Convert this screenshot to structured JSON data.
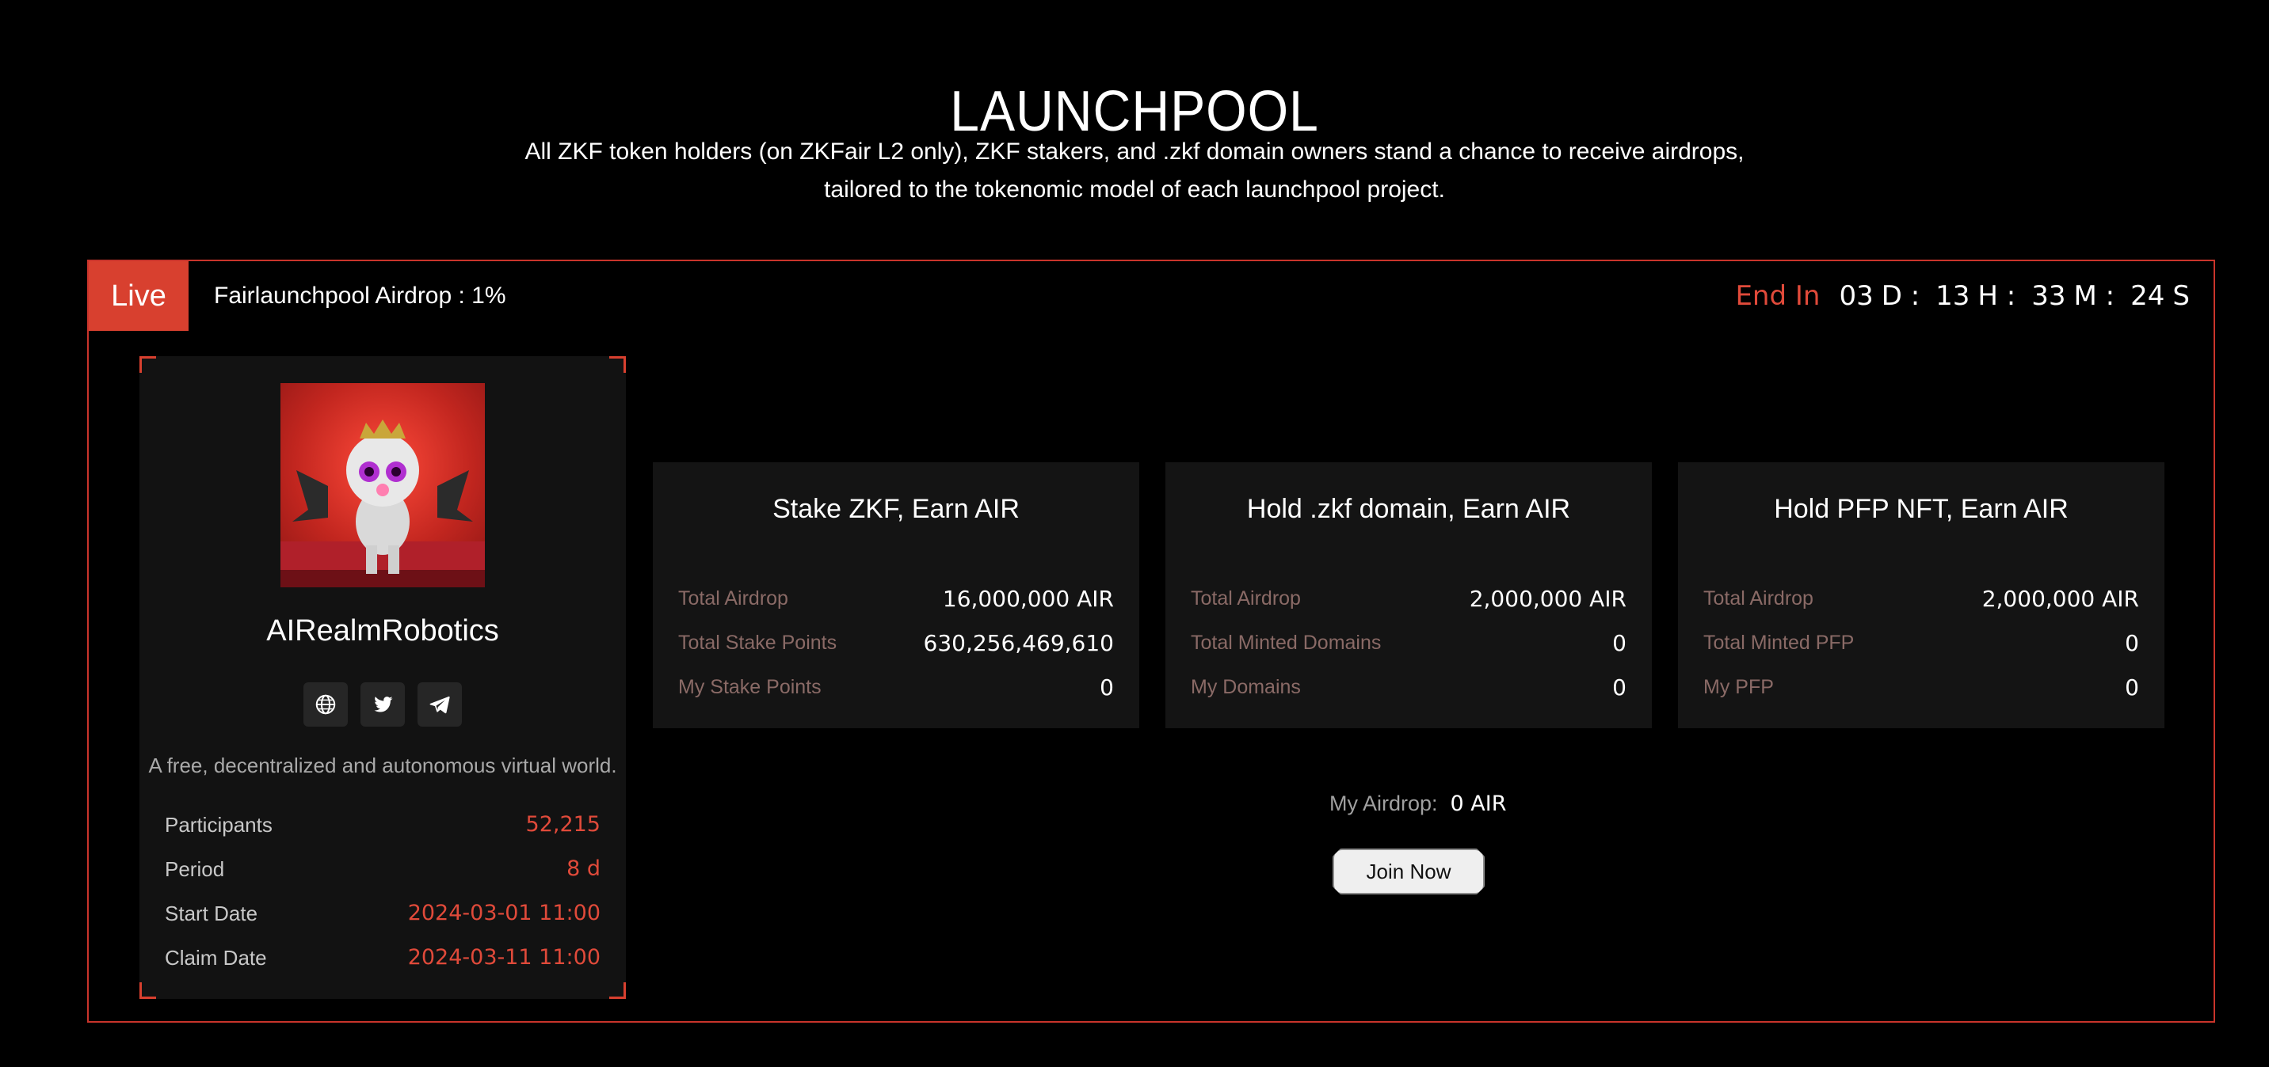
{
  "header": {
    "title": "LAUNCHPOOL",
    "subtitle_line1": "All ZKF token holders (on ZKFair L2 only), ZKF stakers, and .zkf domain owners stand a chance to receive airdrops,",
    "subtitle_line2": "tailored to the tokenomic model of each launchpool project."
  },
  "pool": {
    "status": "Live",
    "airdrop_label": "Fairlaunchpool Airdrop : 1%",
    "countdown": {
      "label": "End In",
      "days": "03",
      "days_unit": "D :",
      "hours": "13",
      "hours_unit": "H :",
      "minutes": "33",
      "minutes_unit": "M :",
      "seconds": "24",
      "seconds_unit": "S"
    }
  },
  "project": {
    "name": "AIRealmRobotics",
    "description": "A free, decentralized and autonomous virtual world.",
    "social_icons": [
      "globe-icon",
      "twitter-icon",
      "telegram-icon"
    ],
    "info": [
      {
        "label": "Participants",
        "value": "52,215"
      },
      {
        "label": "Period",
        "value": "8 d"
      },
      {
        "label": "Start Date",
        "value": "2024-03-01 11:00"
      },
      {
        "label": "Claim Date",
        "value": "2024-03-11 11:00"
      }
    ]
  },
  "rewards": [
    {
      "title": "Stake ZKF, Earn AIR",
      "rows": [
        {
          "label": "Total Airdrop",
          "value": "16,000,000 AIR"
        },
        {
          "label": "Total Stake Points",
          "value": "630,256,469,610"
        },
        {
          "label": "My Stake Points",
          "value": "0"
        }
      ]
    },
    {
      "title": "Hold .zkf domain, Earn AIR",
      "rows": [
        {
          "label": "Total Airdrop",
          "value": "2,000,000 AIR"
        },
        {
          "label": "Total Minted Domains",
          "value": "0"
        },
        {
          "label": "My Domains",
          "value": "0"
        }
      ]
    },
    {
      "title": "Hold PFP NFT, Earn AIR",
      "rows": [
        {
          "label": "Total Airdrop",
          "value": "2,000,000 AIR"
        },
        {
          "label": "Total Minted PFP",
          "value": "0"
        },
        {
          "label": "My PFP",
          "value": "0"
        }
      ]
    }
  ],
  "my_airdrop": {
    "label": "My Airdrop:",
    "value": "0 AIR"
  },
  "join_button": "Join Now",
  "colors": {
    "accent": "#d8402f",
    "background": "#000000",
    "card": "#141414"
  }
}
